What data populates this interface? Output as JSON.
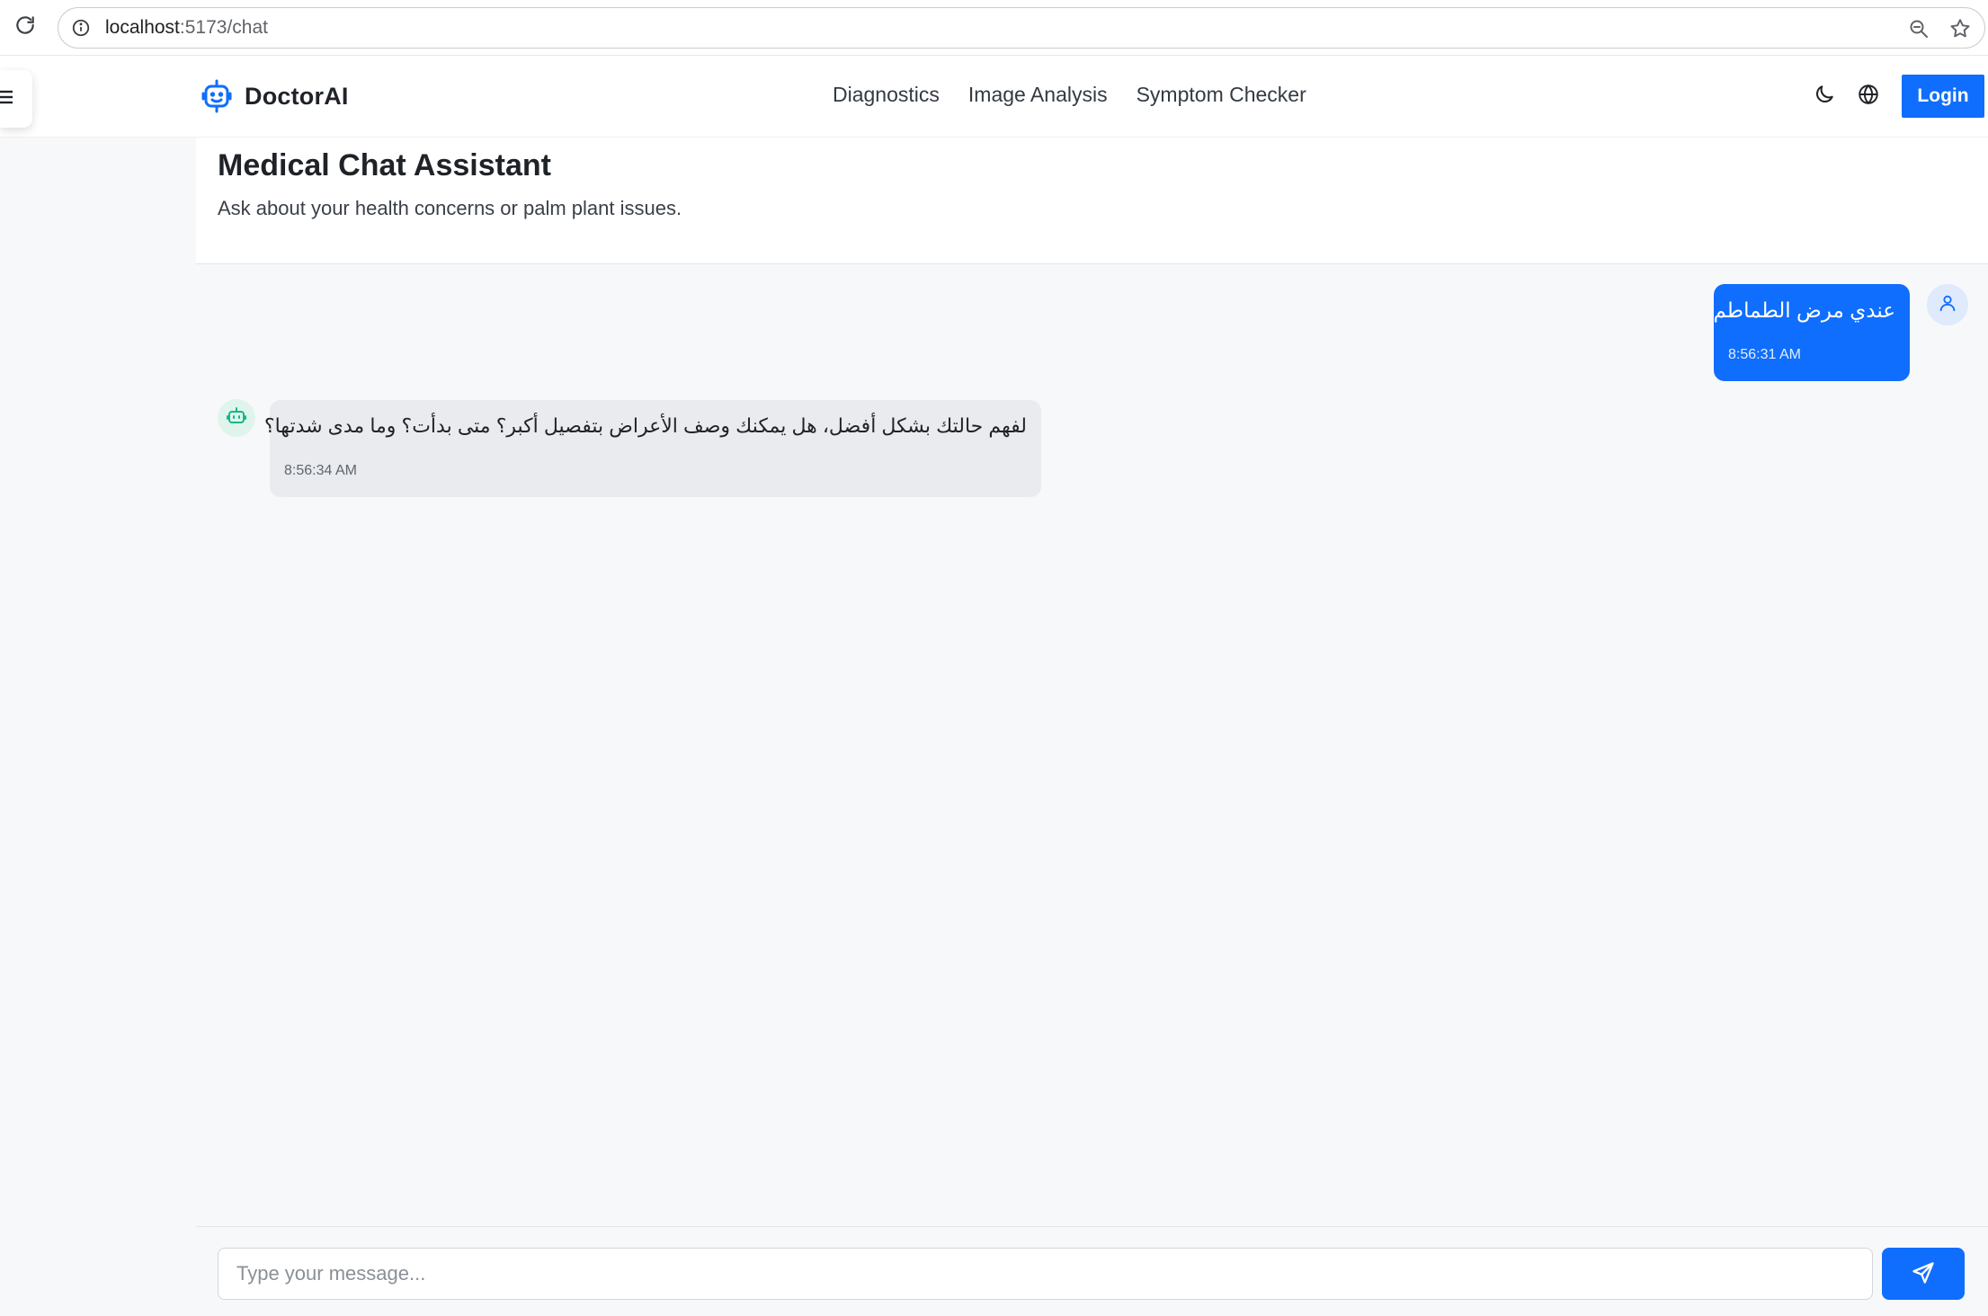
{
  "browser": {
    "url_host": "localhost",
    "url_path": ":5173/chat"
  },
  "nav": {
    "brand": "DoctorAI",
    "links": [
      "Diagnostics",
      "Image Analysis",
      "Symptom Checker"
    ],
    "login_label": "Login"
  },
  "chat": {
    "title": "Medical Chat Assistant",
    "subtitle": "Ask about your health concerns or palm plant issues.",
    "messages": [
      {
        "role": "user",
        "text": "عندي مرض الطماطم",
        "time": "8:56:31 AM"
      },
      {
        "role": "assistant",
        "text": "لفهم حالتك بشكل أفضل، هل يمكنك وصف الأعراض بتفصيل أكبر؟ متى بدأت؟ وما مدى شدتها؟",
        "time": "8:56:34 AM"
      }
    ],
    "input_placeholder": "Type your message...",
    "input_value": ""
  },
  "icons": {
    "reload": "reload-icon",
    "info": "info-icon",
    "zoom": "zoom-out-icon",
    "star": "bookmark-star-icon",
    "menu": "hamburger-menu-icon",
    "brand_logo": "robot-logo-icon",
    "theme": "moon-icon",
    "language": "globe-icon",
    "user": "user-avatar-icon",
    "bot": "bot-avatar-icon",
    "send": "send-icon"
  },
  "colors": {
    "accent": "#0f6efd",
    "user_bubble": "#0f6efd",
    "bot_bubble": "#e9ebee",
    "bot_avatar_bg": "#dff5ec",
    "bot_icon": "#12b886",
    "user_avatar_bg": "#dfeafc",
    "page_bg": "#f7f8fa"
  }
}
